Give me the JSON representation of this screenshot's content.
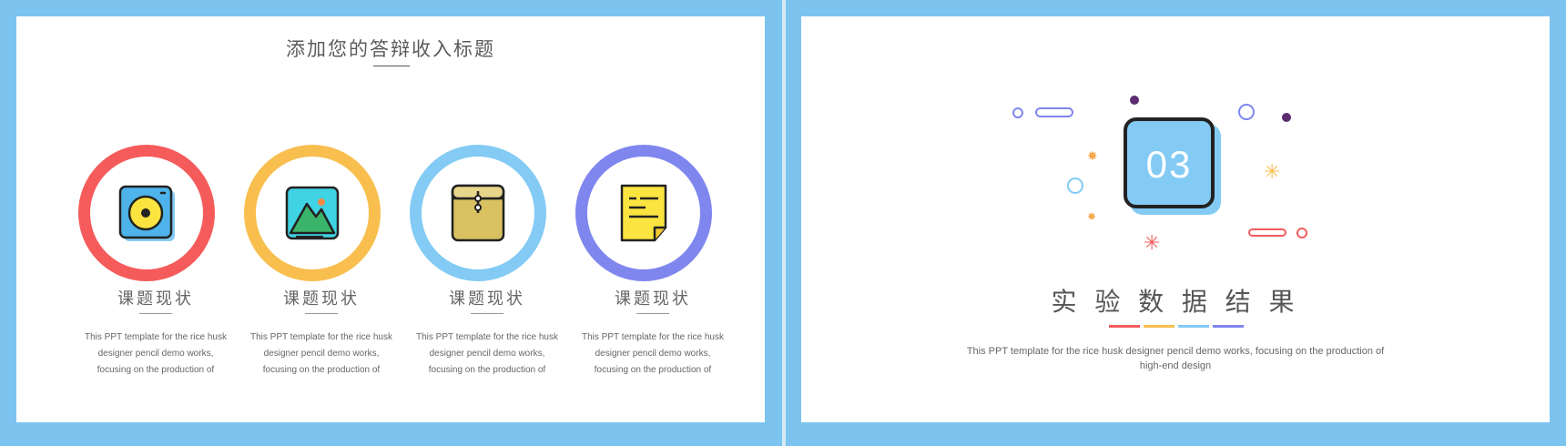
{
  "left_slide": {
    "title": "添加您的答辩收入标题",
    "cards": [
      {
        "icon": "disc-icon",
        "color": "#f55b5b",
        "title": "课题现状",
        "desc_lines": [
          "This PPT template for the rice husk",
          "designer pencil demo works,",
          "focusing on the production of"
        ]
      },
      {
        "icon": "picture-icon",
        "color": "#f8bf4f",
        "title": "课题现状",
        "desc_lines": [
          "This PPT template for the rice husk",
          "designer pencil demo works,",
          "focusing on the production of"
        ]
      },
      {
        "icon": "envelope-icon",
        "color": "#83cbf4",
        "title": "课题现状",
        "desc_lines": [
          "This PPT template for the rice husk",
          "designer pencil demo works,",
          "focusing on the production of"
        ]
      },
      {
        "icon": "document-icon",
        "color": "#7f86ee",
        "title": "课题现状",
        "desc_lines": [
          "This PPT template for the rice husk",
          "designer pencil demo works,",
          "focusing on the production of"
        ]
      }
    ]
  },
  "right_slide": {
    "number": "03",
    "title": "实 验 数 据 结 果",
    "underline_colors": [
      "#f55b5b",
      "#f8bf4f",
      "#83cbf4",
      "#7f86ee"
    ],
    "desc_lines": [
      "This PPT template for the rice husk designer pencil demo works, focusing on the production of",
      "high-end design"
    ]
  },
  "colors": {
    "background": "#7cc4ef",
    "slide": "#ffffff",
    "text": "#5a5a5a"
  }
}
